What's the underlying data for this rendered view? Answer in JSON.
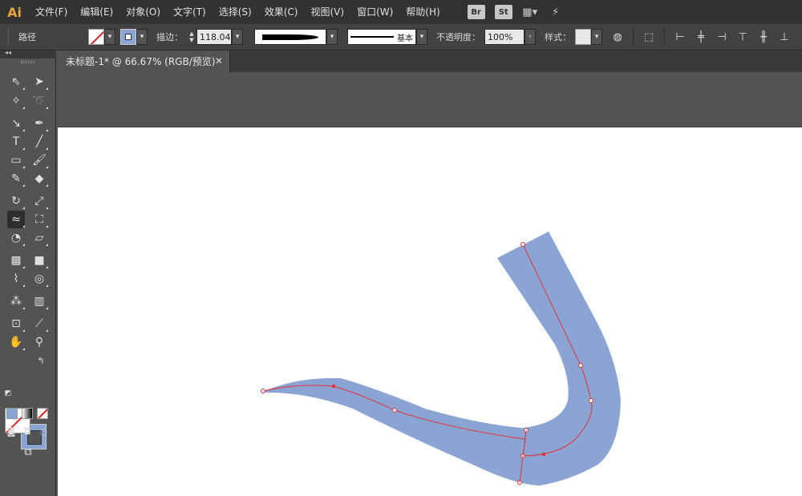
{
  "app": {
    "logo": "Ai",
    "menus": [
      "文件(F)",
      "编辑(E)",
      "对象(O)",
      "文字(T)",
      "选择(S)",
      "效果(C)",
      "视图(V)",
      "窗口(W)",
      "帮助(H)"
    ],
    "ext_bridge": "Br",
    "ext_stock": "St"
  },
  "control_bar": {
    "selection_type": "路径",
    "stroke_label": "描边：",
    "stroke_weight": "118.04",
    "profile_label": "基本",
    "opacity_label": "不透明度：",
    "opacity_value": "100%",
    "style_label": "样式："
  },
  "document": {
    "tab_title": "未标题-1* @ 66.67% (RGB/预览)",
    "close_glyph": "✕"
  },
  "colors": {
    "shape_fill": "#8aa4d4",
    "path_stroke": "#e8313a",
    "accent": "#e8a53c"
  },
  "icons": {
    "selection": "selection-tool-icon",
    "direct_selection": "direct-selection-tool-icon",
    "magic_wand": "magic-wand-icon",
    "lasso": "lasso-icon",
    "pen": "pen-icon",
    "type": "type-icon",
    "hand": "hand-icon",
    "zoom": "zoom-icon"
  }
}
